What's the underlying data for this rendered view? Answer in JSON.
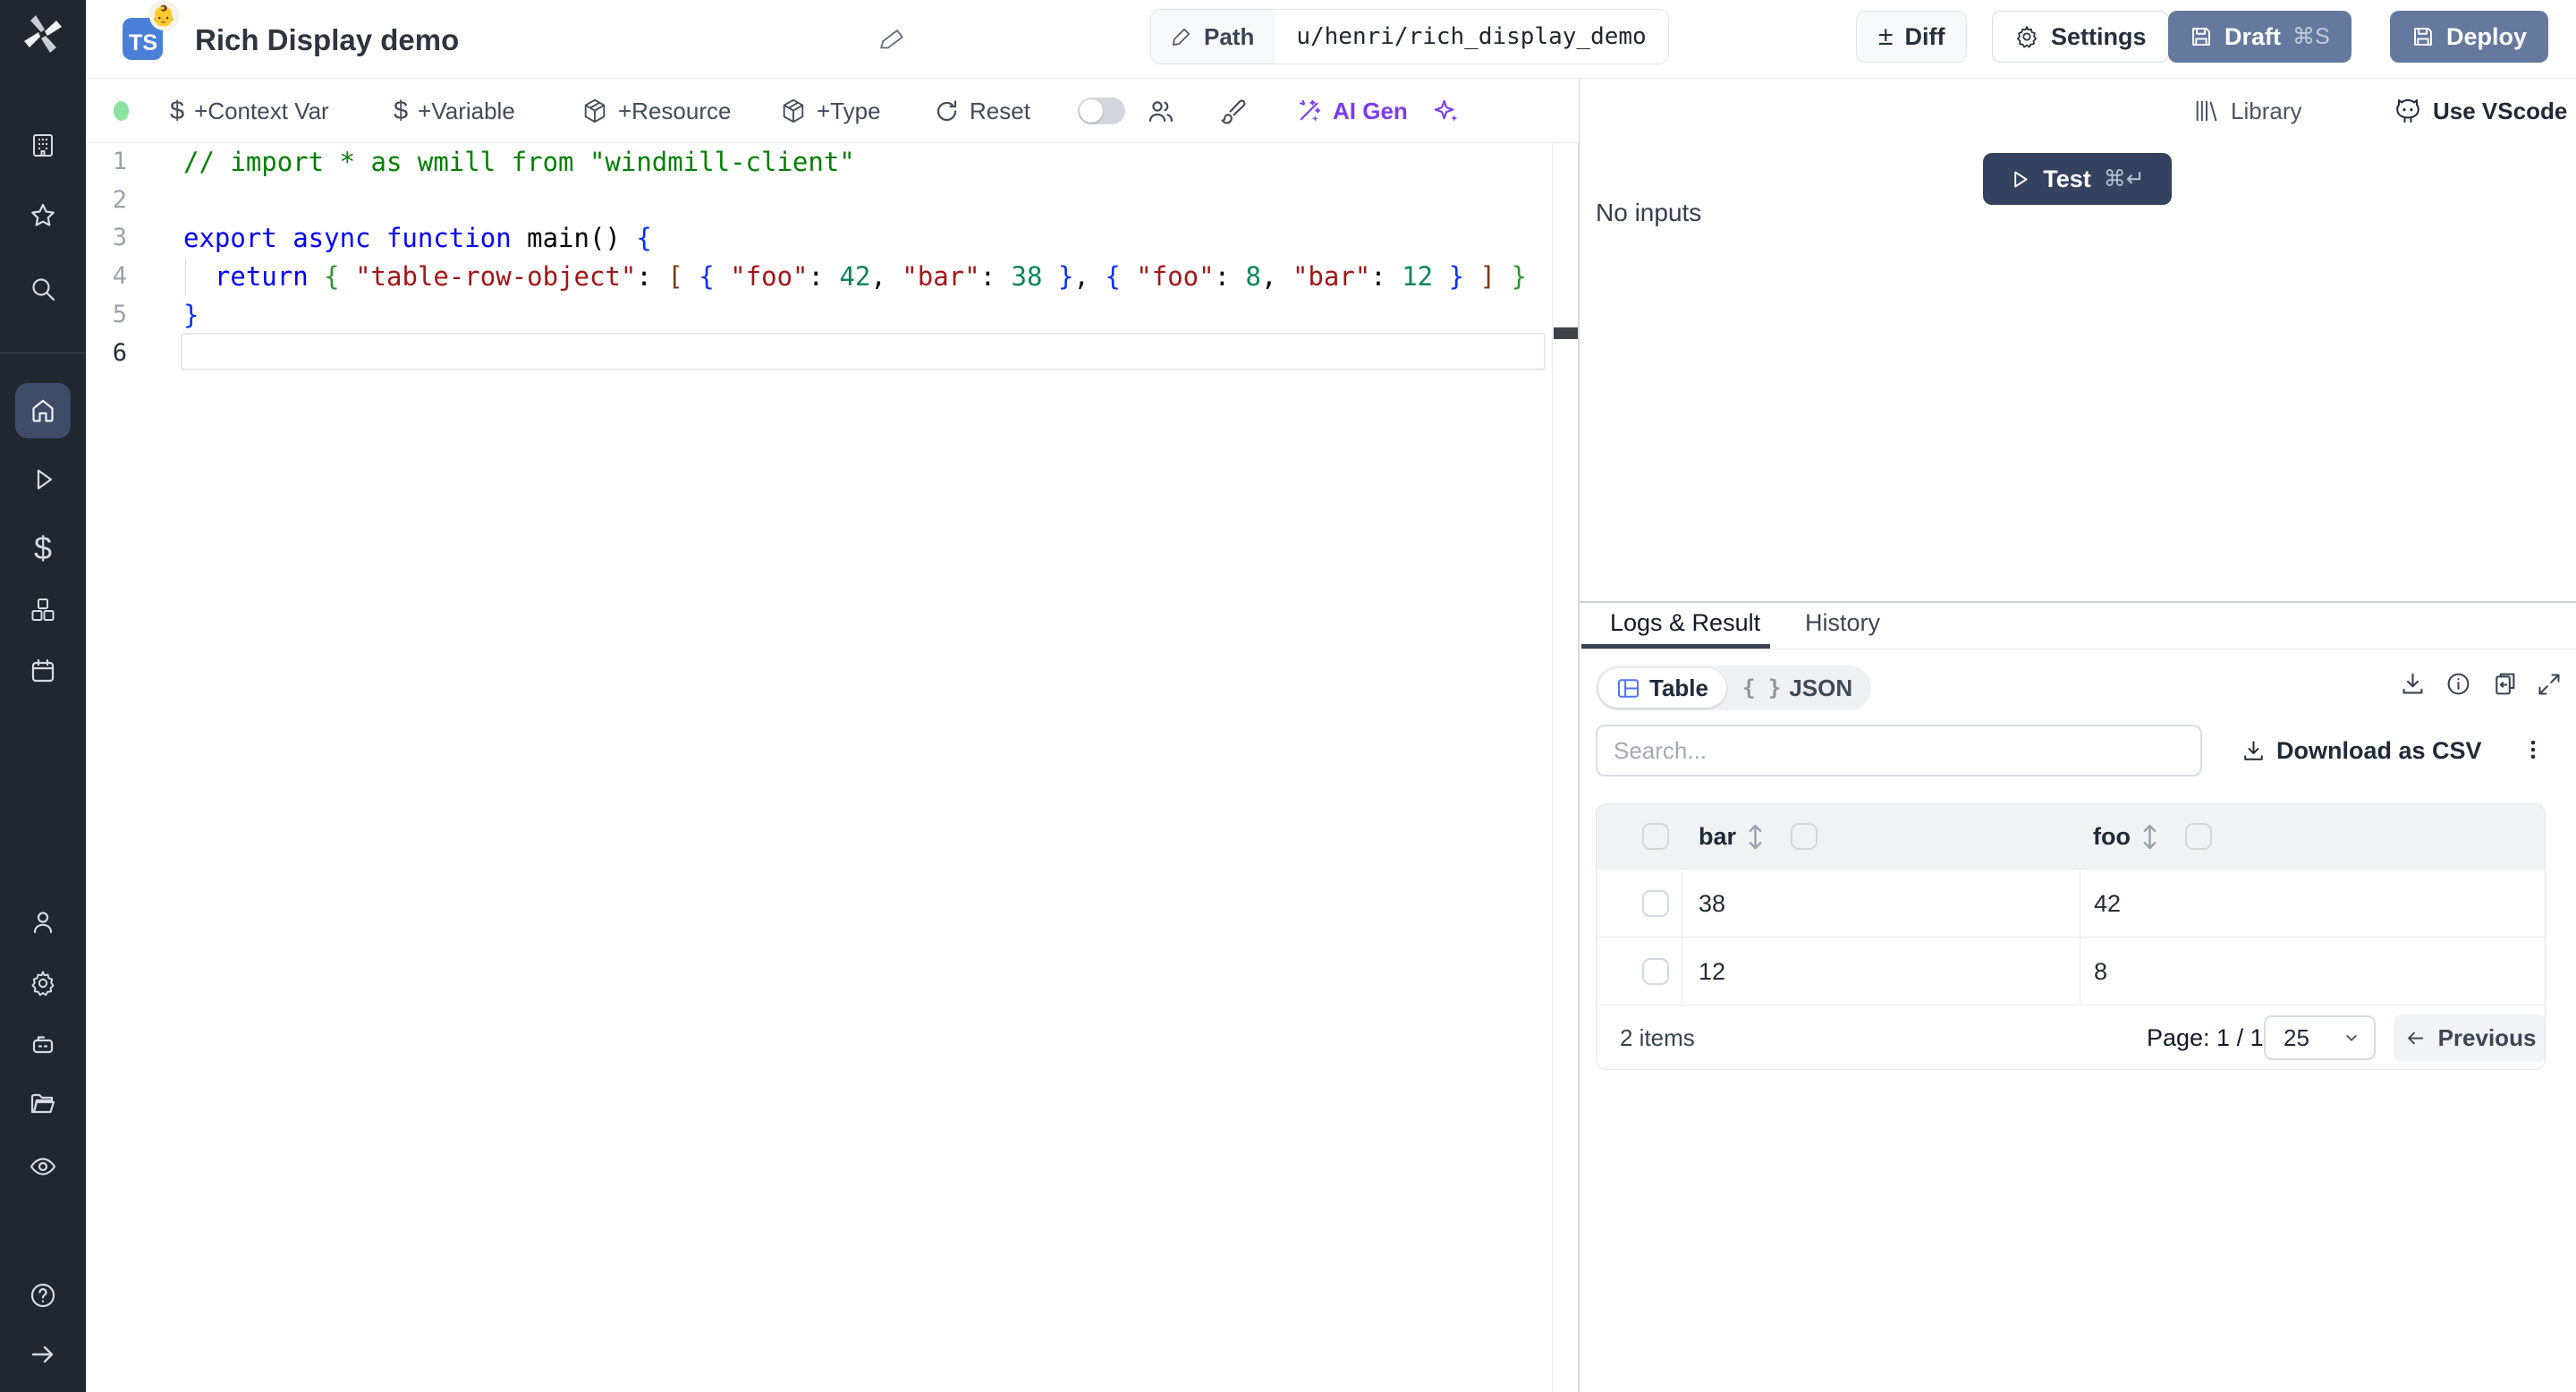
{
  "app": {
    "name": "Windmill"
  },
  "topbar": {
    "lang_badge": "TS",
    "badge_emoji": "👶",
    "title": "Rich Display demo",
    "path_label": "Path",
    "path_value": "u/henri/rich_display_demo",
    "diff_label": "Diff",
    "diff_glyph": "±",
    "settings_label": "Settings",
    "draft_label": "Draft",
    "draft_shortcut": "⌘S",
    "deploy_label": "Deploy",
    "button_blue": "#64799d"
  },
  "toolbar": {
    "status_dot_color": "#8be3a2",
    "dollar_glyph": "$",
    "context_var_label": "+Context Var",
    "variable_label": "+Variable",
    "resource_label": "+Resource",
    "type_label": "+Type",
    "reset_label": "Reset",
    "ai_gen_label": "AI Gen",
    "accent_purple": "#7c3aed",
    "library_label": "Library",
    "vscode_label": "Use VScode"
  },
  "sidebar": {
    "active_item": "home",
    "items": [
      "buildings",
      "star",
      "search",
      "home",
      "runs-play",
      "variables-dollar",
      "resources-cubes",
      "schedules-calendar",
      "user",
      "settings-gear",
      "workers-robot",
      "folders",
      "audit-eye",
      "help-question",
      "collapse-arrow"
    ]
  },
  "editor": {
    "line_numbers": [
      "1",
      "2",
      "3",
      "4",
      "5",
      "6"
    ],
    "lines": [
      {
        "tokens": [
          [
            "cmt",
            "// import * as wmill from \"windmill-client\""
          ]
        ]
      },
      {
        "tokens": []
      },
      {
        "tokens": [
          [
            "kw",
            "export async function "
          ],
          [
            "id",
            "main"
          ],
          [
            "pun",
            "() "
          ],
          [
            "b0",
            "{"
          ]
        ]
      },
      {
        "tokens": [
          [
            "pln",
            "  "
          ],
          [
            "kw",
            "return"
          ],
          [
            "pln",
            " "
          ],
          [
            "b1",
            "{"
          ],
          [
            "pln",
            " "
          ],
          [
            "str",
            "\"table-row-object\""
          ],
          [
            "pun",
            ":"
          ],
          [
            "pln",
            " "
          ],
          [
            "b2",
            "["
          ],
          [
            "pln",
            " "
          ],
          [
            "b0",
            "{"
          ],
          [
            "pln",
            " "
          ],
          [
            "str",
            "\"foo\""
          ],
          [
            "pun",
            ":"
          ],
          [
            "pln",
            " "
          ],
          [
            "num",
            "42"
          ],
          [
            "pun",
            ","
          ],
          [
            "pln",
            " "
          ],
          [
            "str",
            "\"bar\""
          ],
          [
            "pun",
            ":"
          ],
          [
            "pln",
            " "
          ],
          [
            "num",
            "38"
          ],
          [
            "pln",
            " "
          ],
          [
            "b0",
            "}"
          ],
          [
            "pun",
            ","
          ],
          [
            "pln",
            " "
          ],
          [
            "b0",
            "{"
          ],
          [
            "pln",
            " "
          ],
          [
            "str",
            "\"foo\""
          ],
          [
            "pun",
            ":"
          ],
          [
            "pln",
            " "
          ],
          [
            "num",
            "8"
          ],
          [
            "pun",
            ","
          ],
          [
            "pln",
            " "
          ],
          [
            "str",
            "\"bar\""
          ],
          [
            "pun",
            ":"
          ],
          [
            "pln",
            " "
          ],
          [
            "num",
            "12"
          ],
          [
            "pln",
            " "
          ],
          [
            "b0",
            "}"
          ],
          [
            "pln",
            " "
          ],
          [
            "b2",
            "]"
          ],
          [
            "pln",
            " "
          ],
          [
            "b1",
            "}"
          ]
        ]
      },
      {
        "tokens": [
          [
            "b0",
            "}"
          ]
        ]
      },
      {
        "tokens": [],
        "current": true
      }
    ]
  },
  "run_panel": {
    "test_label": "Test",
    "test_shortcut": "⌘↵",
    "no_inputs": "No inputs",
    "test_button_color": "#35425f"
  },
  "result_panel": {
    "tabs": [
      {
        "label": "Logs & Result",
        "active": true
      },
      {
        "label": "History",
        "active": false
      }
    ],
    "view_toggle": [
      {
        "label": "Table",
        "active": true,
        "icon_color": "#4f74f8"
      },
      {
        "label": "JSON",
        "active": false,
        "glyph": "{ }"
      }
    ],
    "search_placeholder": "Search...",
    "download_csv_label": "Download as CSV",
    "table": {
      "columns": [
        "bar",
        "foo"
      ],
      "rows": [
        [
          "38",
          "42"
        ],
        [
          "12",
          "8"
        ]
      ],
      "items_label": "2 items",
      "page_label": "Page: 1 / 1",
      "page_size": "25",
      "previous_label": "Previous"
    }
  }
}
